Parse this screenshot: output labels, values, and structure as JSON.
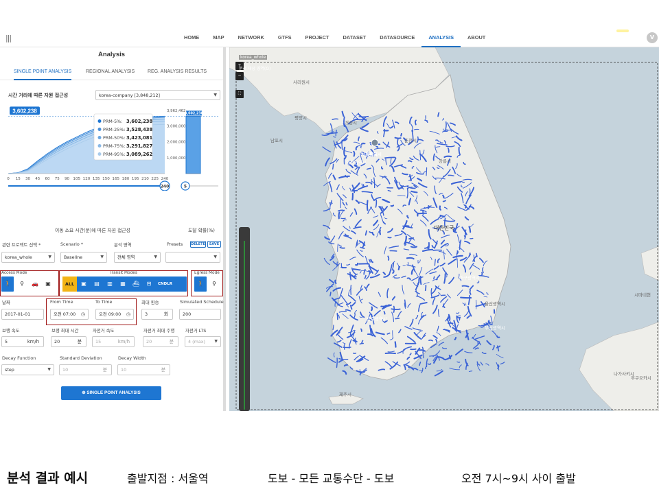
{
  "nav": {
    "menu_icon": "hamburger-icon",
    "items": [
      "HOME",
      "MAP",
      "NETWORK",
      "GTFS",
      "PROJECT",
      "DATASET",
      "DATASOURCE",
      "ANALYSIS",
      "ABOUT"
    ],
    "active": "ANALYSIS",
    "avatar_letter": "V"
  },
  "panel": {
    "title": "Analysis",
    "tabs": [
      "SINGLE POINT ANALYSIS",
      "REGIONAL ANALYSIS",
      "REG. ANALYSIS RESULTS"
    ],
    "active_tab": "SINGLE POINT ANALYSIS",
    "accessibility_label": "시간 거리에 따른 자원 접근성",
    "destination_select": "korea-company [3,848,212]"
  },
  "chart_data": {
    "type": "area",
    "title": "",
    "xlabel": "이동 소요 시간(분)에 따른 자원 접근성",
    "ylabel": "",
    "x_ticks": [
      "0",
      "15",
      "30",
      "45",
      "60",
      "75",
      "90",
      "105",
      "120",
      "135",
      "150",
      "165",
      "180",
      "195",
      "210",
      "225",
      "240"
    ],
    "xlim": [
      0,
      240
    ],
    "ylim": [
      0,
      3962462
    ],
    "y_ticks": [
      "3,962,462",
      "3,000,000",
      "2,000,000",
      "1,000,000"
    ],
    "highlight_value": "3,602,238",
    "x": [
      0,
      15,
      30,
      45,
      60,
      75,
      90,
      105,
      120,
      135,
      150,
      165,
      180,
      195,
      210,
      225,
      240
    ],
    "series": [
      {
        "name": "PRM-5%",
        "value_label": "3,602,238",
        "values": [
          0,
          60000,
          300000,
          800000,
          1250000,
          1650000,
          2000000,
          2300000,
          2600000,
          2850000,
          3050000,
          3220000,
          3360000,
          3460000,
          3530000,
          3580000,
          3602238
        ]
      },
      {
        "name": "PRM-25%",
        "value_label": "3,528,438",
        "values": [
          0,
          50000,
          270000,
          740000,
          1180000,
          1570000,
          1920000,
          2220000,
          2510000,
          2760000,
          2960000,
          3130000,
          3270000,
          3380000,
          3450000,
          3500000,
          3528438
        ]
      },
      {
        "name": "PRM-50%",
        "value_label": "3,423,081",
        "values": [
          0,
          45000,
          240000,
          680000,
          1100000,
          1480000,
          1820000,
          2110000,
          2400000,
          2650000,
          2850000,
          3020000,
          3160000,
          3270000,
          3350000,
          3400000,
          3423081
        ]
      },
      {
        "name": "PRM-75%",
        "value_label": "3,291,827",
        "values": [
          0,
          40000,
          210000,
          610000,
          1010000,
          1370000,
          1700000,
          1990000,
          2270000,
          2520000,
          2720000,
          2890000,
          3030000,
          3140000,
          3220000,
          3270000,
          3291827
        ]
      },
      {
        "name": "PRM-95%",
        "value_label": "3,089,262",
        "values": [
          0,
          30000,
          170000,
          520000,
          890000,
          1230000,
          1550000,
          1830000,
          2100000,
          2340000,
          2540000,
          2710000,
          2840000,
          2950000,
          3030000,
          3070000,
          3089262
        ]
      }
    ],
    "slider_time": "240",
    "bar_value_label": "3,602,238",
    "bar_value": 3602238,
    "side_slider": "5",
    "side_xlabel": "도달 확률(%)"
  },
  "form": {
    "project_label": "관련 프로젝트 선택 *",
    "project_value": "korea_whole",
    "scenario_label": "Scenario *",
    "scenario_value": "Baseline",
    "area_label": "분석 영역",
    "area_value": "전체 영역",
    "presets_label": "Presets",
    "delete_label": "DELETE",
    "save_label": "SAVE",
    "access_label": "Access Mode",
    "transit_label": "Transit Modes",
    "egress_label": "Egress Mode",
    "transit_all": "ALL",
    "transit_extra": "CNDLR FNCLR",
    "date_label": "날짜",
    "date_value": "2017-01-01",
    "from_label": "From Time",
    "from_value": "오전 07:00",
    "to_label": "To Time",
    "to_value": "오전 09:00",
    "max_transfer_label": "최대 환승",
    "max_transfer_value": "3",
    "max_transfer_unit": "회",
    "sim_label": "Simulated Schedule",
    "sim_value": "200",
    "walk_speed_label": "보행 속도",
    "walk_speed_value": "5",
    "walk_speed_unit": "km/h",
    "walk_time_label": "보행 최대 시간",
    "walk_time_value": "20",
    "walk_time_unit": "분",
    "bike_speed_label": "자전거 속도",
    "bike_speed_value": "15",
    "bike_speed_unit": "km/h",
    "bike_time_label": "자전거 최대 주행",
    "bike_time_value": "20",
    "bike_time_unit": "분",
    "bike_lts_label": "자전거 LTS",
    "bike_lts_value": "4 (max)",
    "decay_label": "Decay Function",
    "decay_value": "step",
    "std_label": "Standard Deviation",
    "std_value": "10",
    "std_unit": "분",
    "width_label": "Decay Width",
    "width_value": "10",
    "width_unit": "분",
    "run_button": "SINGLE POINT ANALYSIS"
  },
  "map": {
    "layer_label": "korea_whole",
    "layer_sub": "분석 대상 영역(O)",
    "labels": [
      "사리원시",
      "평양시",
      "남포시",
      "개성시",
      "서울특별시",
      "인천광역시",
      "춘천시",
      "강릉시",
      "대한민국",
      "대구광역시",
      "울산광역시",
      "부산광역시",
      "광주광역시",
      "제주시",
      "나가사키시",
      "후쿠오카시",
      "시마네현"
    ],
    "colors": {
      "network": "#3b63d6",
      "land": "#eeeeea",
      "sea": "#c5d3dc",
      "accent": "#1e76d2"
    }
  },
  "caption": {
    "title": "분석 결과 예시",
    "origin": "출발지점 : 서울역",
    "mode": "도보 - 모든 교통수단 - 도보",
    "time": "오전 7시~9시 사이 출발"
  }
}
